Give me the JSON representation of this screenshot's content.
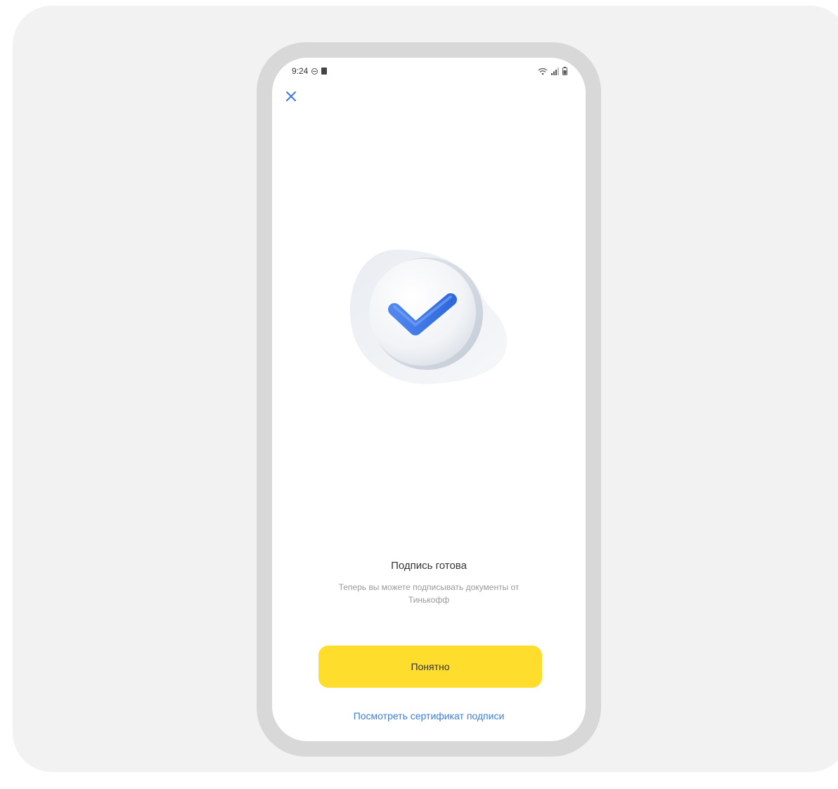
{
  "status_bar": {
    "time": "9:24",
    "icons": [
      "do-not-disturb-icon",
      "sim-card-icon",
      "wifi-icon",
      "signal-icon",
      "battery-icon"
    ]
  },
  "header": {
    "close_icon": "close-icon"
  },
  "illustration": {
    "icon": "checkmark-badge-icon",
    "check_color": "#3e77e8"
  },
  "content": {
    "title": "Подпись готова",
    "subtitle": "Теперь вы можете подписывать документы от Тинькофф"
  },
  "actions": {
    "primary_label": "Понятно",
    "primary_color": "#ffdd2d",
    "link_label": "Посмотреть сертификат подписи",
    "link_color": "#3b7ddc"
  }
}
